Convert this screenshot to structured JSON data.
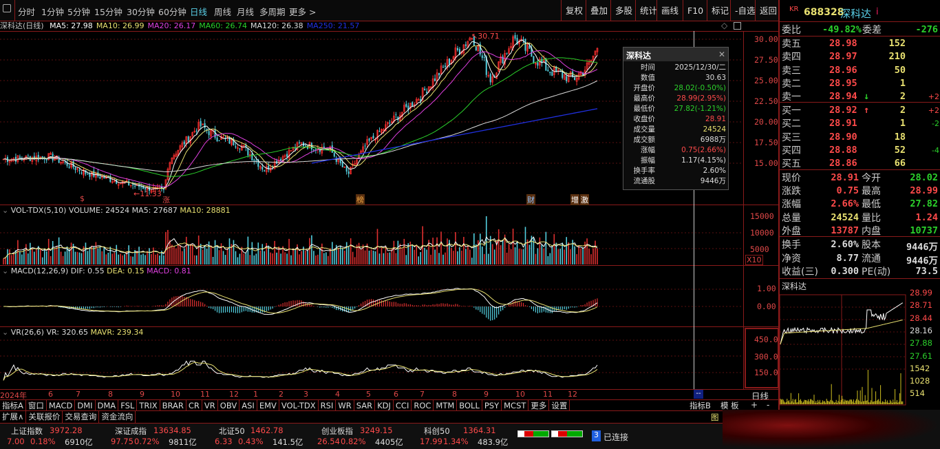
{
  "toolbar": {
    "periods": [
      "分时",
      "1分钟",
      "5分钟",
      "15分钟",
      "30分钟",
      "60分钟",
      "日线",
      "周线",
      "月线",
      "多周期",
      "更多 >"
    ],
    "active": "日线",
    "right_buttons": [
      "复权",
      "叠加",
      "多股",
      "统计",
      "画线",
      "F10",
      "标记",
      "-自选",
      "返回"
    ]
  },
  "main": {
    "title": "深科达(日线)",
    "ma": [
      {
        "label": "MA5: 27.98",
        "color": "#ffffff"
      },
      {
        "label": "MA10: 26.99",
        "color": "#e8e070"
      },
      {
        "label": "MA20: 26.17",
        "color": "#e040e0"
      },
      {
        "label": "MA60: 26.74",
        "color": "#2bd12b"
      },
      {
        "label": "MA120: 26.38",
        "color": "#dddddd"
      },
      {
        "label": "MA250: 21.57",
        "color": "#2030e0"
      }
    ],
    "high_label": "30.71",
    "low_label": "11.33",
    "price_axis": [
      "30.00",
      "27.50",
      "25.00",
      "22.50",
      "20.00",
      "17.50",
      "15.00"
    ],
    "markers": [
      "$",
      "涨",
      "榜",
      "财",
      "增",
      "激"
    ],
    "price_keypoints": [
      [
        0,
        15.5
      ],
      [
        0.08,
        15.8
      ],
      [
        0.14,
        13.8
      ],
      [
        0.22,
        12.3
      ],
      [
        0.27,
        11.6
      ],
      [
        0.28,
        15.5
      ],
      [
        0.33,
        19.6
      ],
      [
        0.36,
        18.2
      ],
      [
        0.4,
        17.2
      ],
      [
        0.44,
        14.2
      ],
      [
        0.5,
        17.4
      ],
      [
        0.55,
        16.6
      ],
      [
        0.58,
        13.6
      ],
      [
        0.61,
        17.2
      ],
      [
        0.66,
        20.5
      ],
      [
        0.7,
        23
      ],
      [
        0.76,
        28.2
      ],
      [
        0.79,
        30.5
      ],
      [
        0.82,
        25.2
      ],
      [
        0.86,
        30.2
      ],
      [
        0.89,
        28
      ],
      [
        0.92,
        26.2
      ],
      [
        0.96,
        25.2
      ],
      [
        0.985,
        26.8
      ],
      [
        1,
        28.91
      ]
    ]
  },
  "tooltip": {
    "title": "深科达",
    "rows": [
      {
        "k": "时间",
        "v": "2025/12/30/二",
        "c": "#dddddd"
      },
      {
        "k": "数值",
        "v": "30.63",
        "c": "#dddddd"
      },
      {
        "k": "开盘价",
        "v": "28.02(-0.50%)",
        "c": "#2bd12b"
      },
      {
        "k": "最高价",
        "v": "28.99(2.95%)",
        "c": "#ff4a4a"
      },
      {
        "k": "最低价",
        "v": "27.82(-1.21%)",
        "c": "#2bd12b"
      },
      {
        "k": "收盘价",
        "v": "28.91",
        "c": "#ff4a4a"
      },
      {
        "k": "成交量",
        "v": "24524",
        "c": "#e8e070"
      },
      {
        "k": "成交额",
        "v": "6988万",
        "c": "#dddddd"
      },
      {
        "k": "涨幅",
        "v": "0.75(2.66%)",
        "c": "#ff4a4a"
      },
      {
        "k": "振幅",
        "v": "1.17(4.15%)",
        "c": "#dddddd"
      },
      {
        "k": "换手率",
        "v": "2.60%",
        "c": "#dddddd"
      },
      {
        "k": "流通股",
        "v": "9446万",
        "c": "#dddddd"
      }
    ]
  },
  "vol": {
    "title": "VOL-TDX(5,10)",
    "volume": "VOLUME: 24524",
    "ma5": "MA5: 27687",
    "ma10": "MA10: 28881",
    "axis": [
      "15000",
      "10000",
      "5000"
    ],
    "unit": "X10"
  },
  "macd": {
    "title": "MACD(12,26,9)",
    "dif": "DIF: 0.55",
    "dea": "DEA: 0.15",
    "macd": "MACD: 0.81",
    "axis": [
      "1.00",
      "0.00"
    ]
  },
  "vr": {
    "title": "VR(26,6)",
    "vr": "VR: 320.65",
    "mavr": "MAVR: 239.34",
    "axis": [
      "450.0",
      "300.0",
      "150.0"
    ]
  },
  "date_axis": [
    "2024年",
    "6",
    "7",
    "8",
    "9",
    "10",
    "11",
    "12",
    "1",
    "2",
    "3",
    "4",
    "5",
    "6",
    "7",
    "8",
    "9",
    "10",
    "11",
    "12"
  ],
  "period_label": "日线",
  "cursor_label": "--",
  "indicator_tabs": [
    "指标A",
    "窗口",
    "MACD",
    "DMI",
    "DMA",
    "FSL",
    "TRIX",
    "BRAR",
    "CR",
    "VR",
    "OBV",
    "ASI",
    "EMV",
    "VOL-TDX",
    "RSI",
    "WR",
    "SAR",
    "KDJ",
    "CCI",
    "ROC",
    "MTM",
    "BOLL",
    "PSY",
    "MCST",
    "更多",
    "设置"
  ],
  "indicator_b": "指标B",
  "template": "模 板",
  "plus": "+",
  "minus": "-",
  "ext_tabs": [
    "扩展∧",
    "关联报价",
    "交易查询",
    "资金流向"
  ],
  "ext_right": "图",
  "quote": {
    "market": "KR",
    "code": "688328",
    "name": "深科达",
    "info": "i",
    "weibi_label": "委比",
    "weibi": "-49.82%",
    "weicha_label": "委差",
    "weicha": "-276",
    "asks": [
      {
        "l": "卖五",
        "p": "28.98",
        "v": "152",
        "d": ""
      },
      {
        "l": "卖四",
        "p": "28.97",
        "v": "210",
        "d": ""
      },
      {
        "l": "卖三",
        "p": "28.96",
        "v": "50",
        "d": ""
      },
      {
        "l": "卖二",
        "p": "28.95",
        "v": "1",
        "d": ""
      },
      {
        "l": "卖一",
        "p": "28.94",
        "v": "2",
        "d": "+2",
        "arrow": "↓"
      }
    ],
    "bids": [
      {
        "l": "买一",
        "p": "28.92",
        "v": "2",
        "d": "+2",
        "arrow": "↑"
      },
      {
        "l": "买二",
        "p": "28.91",
        "v": "1",
        "d": "-2"
      },
      {
        "l": "买三",
        "p": "28.90",
        "v": "18",
        "d": ""
      },
      {
        "l": "买四",
        "p": "28.88",
        "v": "52",
        "d": "-4"
      },
      {
        "l": "买五",
        "p": "28.86",
        "v": "66",
        "d": ""
      }
    ],
    "stats": [
      {
        "l1": "现价",
        "v1": "28.91",
        "c1": "red",
        "l2": "今开",
        "v2": "28.02",
        "c2": "grn"
      },
      {
        "l1": "涨跌",
        "v1": "0.75",
        "c1": "red",
        "l2": "最高",
        "v2": "28.99",
        "c2": "red"
      },
      {
        "l1": "涨幅",
        "v1": "2.66%",
        "c1": "red",
        "l2": "最低",
        "v2": "27.82",
        "c2": "grn"
      },
      {
        "l1": "总量",
        "v1": "24524",
        "c1": "yel",
        "l2": "量比",
        "v2": "1.24",
        "c2": "red"
      },
      {
        "l1": "外盘",
        "v1": "13787",
        "c1": "red",
        "l2": "内盘",
        "v2": "10737",
        "c2": "grn"
      }
    ],
    "stats2": [
      {
        "l1": "换手",
        "v1": "2.60%",
        "l2": "股本",
        "v2": "9446万"
      },
      {
        "l1": "净资",
        "v1": "8.77",
        "l2": "流通",
        "v2": "9446万"
      },
      {
        "l1": "收益(三)",
        "v1": "0.300",
        "l2": "PE(动)",
        "v2": "73.5"
      }
    ]
  },
  "intraday": {
    "title": "深科达",
    "price_axis": [
      "28.99",
      "28.71",
      "28.44",
      "28.16",
      "27.88",
      "27.61"
    ],
    "vol_axis": [
      "1542",
      "1028",
      "514"
    ]
  },
  "status": {
    "indices": [
      {
        "name": "上证指数",
        "value": "3972.28",
        "chg": "7.00",
        "pct": "0.18%",
        "amt": "6910亿"
      },
      {
        "name": "深证成指",
        "value": "13634.85",
        "chg": "97.75",
        "pct": "0.72%",
        "amt": "9811亿"
      },
      {
        "name": "北证50",
        "value": "1462.78",
        "chg": "6.33",
        "pct": "0.43%",
        "amt": "141.5亿"
      },
      {
        "name": "创业板指",
        "value": "3249.15",
        "chg": "26.54",
        "pct": "0.82%",
        "amt": "4405亿"
      },
      {
        "name": "科创50",
        "value": "1364.31",
        "chg": "17.99",
        "pct": "1.34%",
        "amt": "483.9亿"
      }
    ],
    "conn_count": "3",
    "conn_label": "已连接"
  }
}
